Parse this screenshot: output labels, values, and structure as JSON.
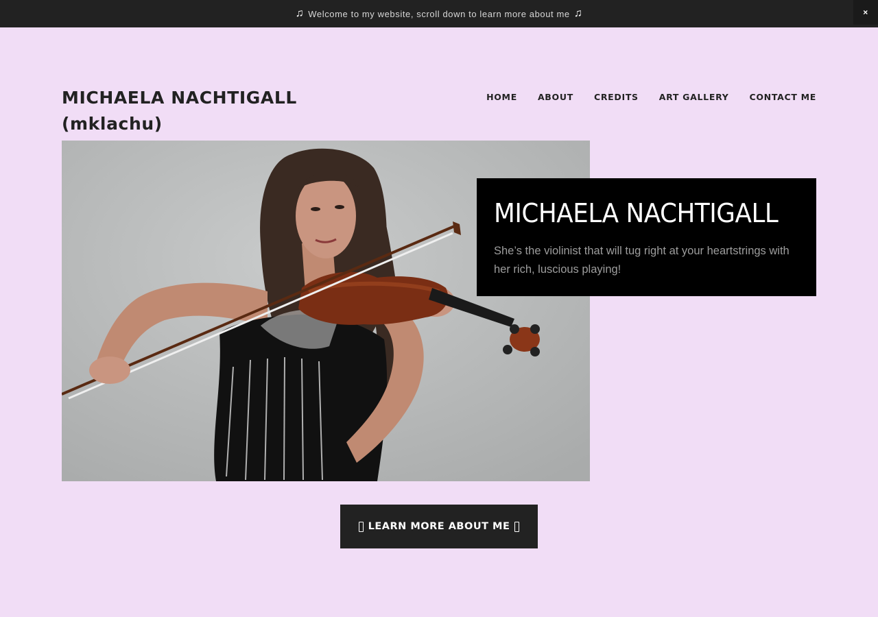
{
  "announcement": {
    "text": "Welcome to my website, scroll down to learn more about me",
    "left_icon": "music-note-icon",
    "right_icon": "music-note-icon",
    "close_label": "×"
  },
  "header": {
    "title_line1": "MICHAELA NACHTIGALL",
    "title_line2": "(mklachu)"
  },
  "nav": {
    "items": [
      {
        "label": "HOME"
      },
      {
        "label": "ABOUT"
      },
      {
        "label": "CREDITS"
      },
      {
        "label": "ART GALLERY"
      },
      {
        "label": "CONTACT ME"
      }
    ]
  },
  "hero": {
    "photo": "violinist-photo",
    "name": "MICHAELA NACHTIGALL",
    "tagline": "She’s the violinist that will tug right at your heartstrings with her rich, luscious playing!"
  },
  "cta": {
    "label": "LEARN MORE ABOUT ME"
  },
  "colors": {
    "background": "#f1ddf6",
    "bar": "#222222",
    "card": "#000000",
    "tagline": "#9d9d9d"
  }
}
